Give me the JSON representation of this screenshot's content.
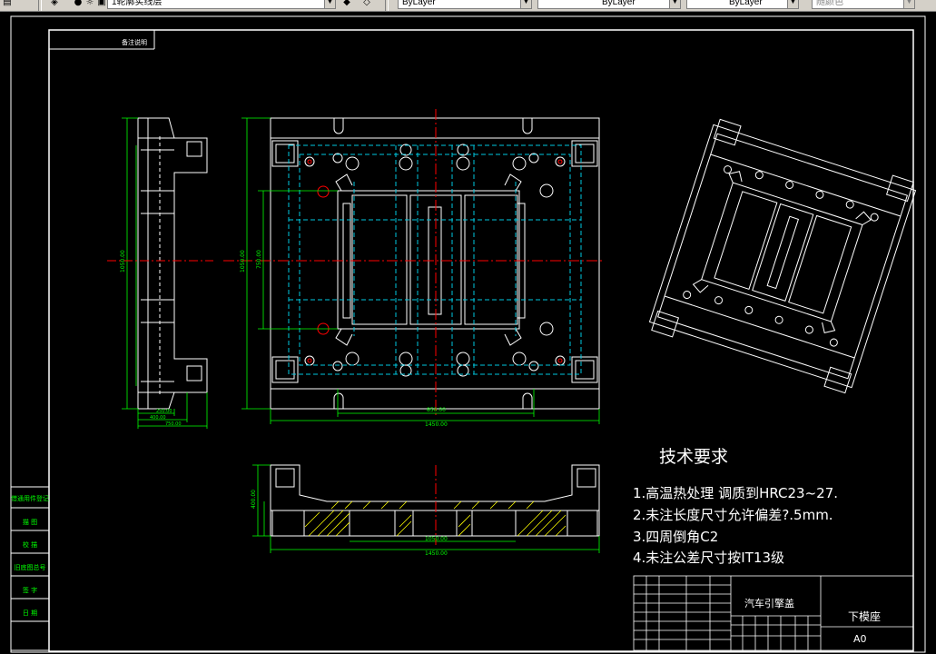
{
  "toolbar": {
    "layer_name": "1轮廓实线层",
    "color_value": "ByLayer",
    "linetype_value": "ByLayer",
    "lineweight_value": "ByLayer",
    "plotstyle_value": "随颜色"
  },
  "drawing": {
    "title_small": "备注说明",
    "tech_requirements": {
      "heading": "技术要求",
      "items": [
        "1.高温热处理  调质到HRC23~27.",
        "2.未注长度尺寸允许偏差?.5mm.",
        "3.四周倒角C2",
        "4.未注公差尺寸按IT13级"
      ]
    },
    "title_block": {
      "project": "汽车引擎盖",
      "part_name": "下模座",
      "sheet_size": "A0"
    },
    "side_labels": [
      "借通用件登记",
      "描   图",
      "校   描",
      "旧底图总号",
      "签   字",
      "日   期"
    ],
    "dimensions": {
      "side_height": "1050.00",
      "side_width_1": "250.00",
      "side_width_2": "400.00",
      "side_width_3": "750.00",
      "top_height": "1050.00",
      "top_inner_height": "750.00",
      "top_width_inner": "850.00",
      "top_width": "1450.00",
      "front_height": "400.00",
      "front_inner": "1050.00",
      "front_width": "1450.00"
    }
  },
  "colors": {
    "background": "#000000",
    "outline": "#ffffff",
    "hidden": "#00c8e0",
    "dimension": "#00ff00",
    "center": "#ff0000",
    "hatch": "#ffff00"
  }
}
